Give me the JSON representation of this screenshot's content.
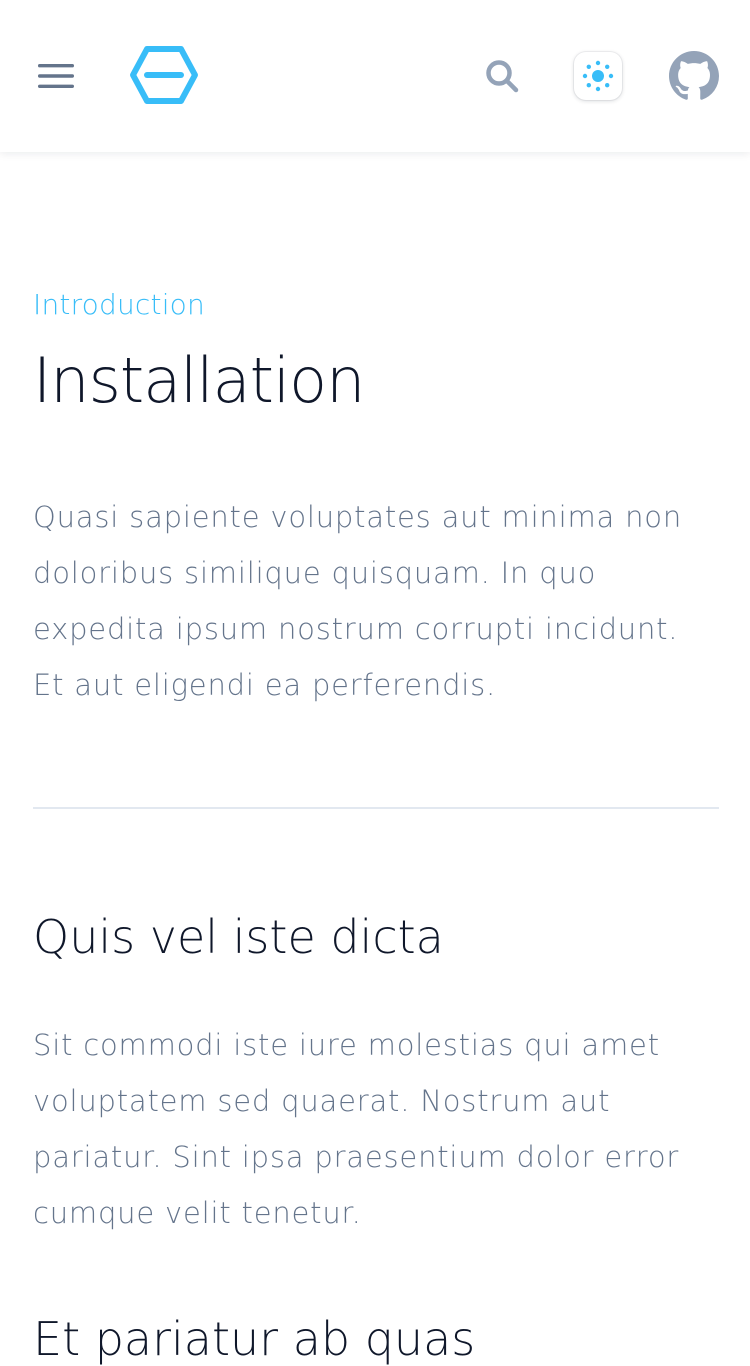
{
  "header": {
    "menu_icon": "hamburger-menu-icon",
    "logo_icon": "hexagon-logo-icon",
    "search_icon": "search-icon",
    "theme_icon": "sun-icon",
    "github_icon": "github-icon",
    "colors": {
      "accent": "#38bdf8",
      "icon": "#94a3b8",
      "menu": "#64748b"
    }
  },
  "main": {
    "eyebrow": "Introduction",
    "title": "Installation",
    "intro": "Quasi sapiente voluptates aut minima non doloribus similique quisquam. In quo expedita ipsum nostrum corrupti incidunt. Et aut eligendi ea perferendis.",
    "sections": [
      {
        "title": "Quis vel iste dicta",
        "body": "Sit commodi iste iure molestias qui amet voluptatem sed quaerat. Nostrum aut pariatur. Sint ipsa praesentium dolor error cumque velit tenetur."
      },
      {
        "title": "Et pariatur ab quas"
      }
    ]
  }
}
